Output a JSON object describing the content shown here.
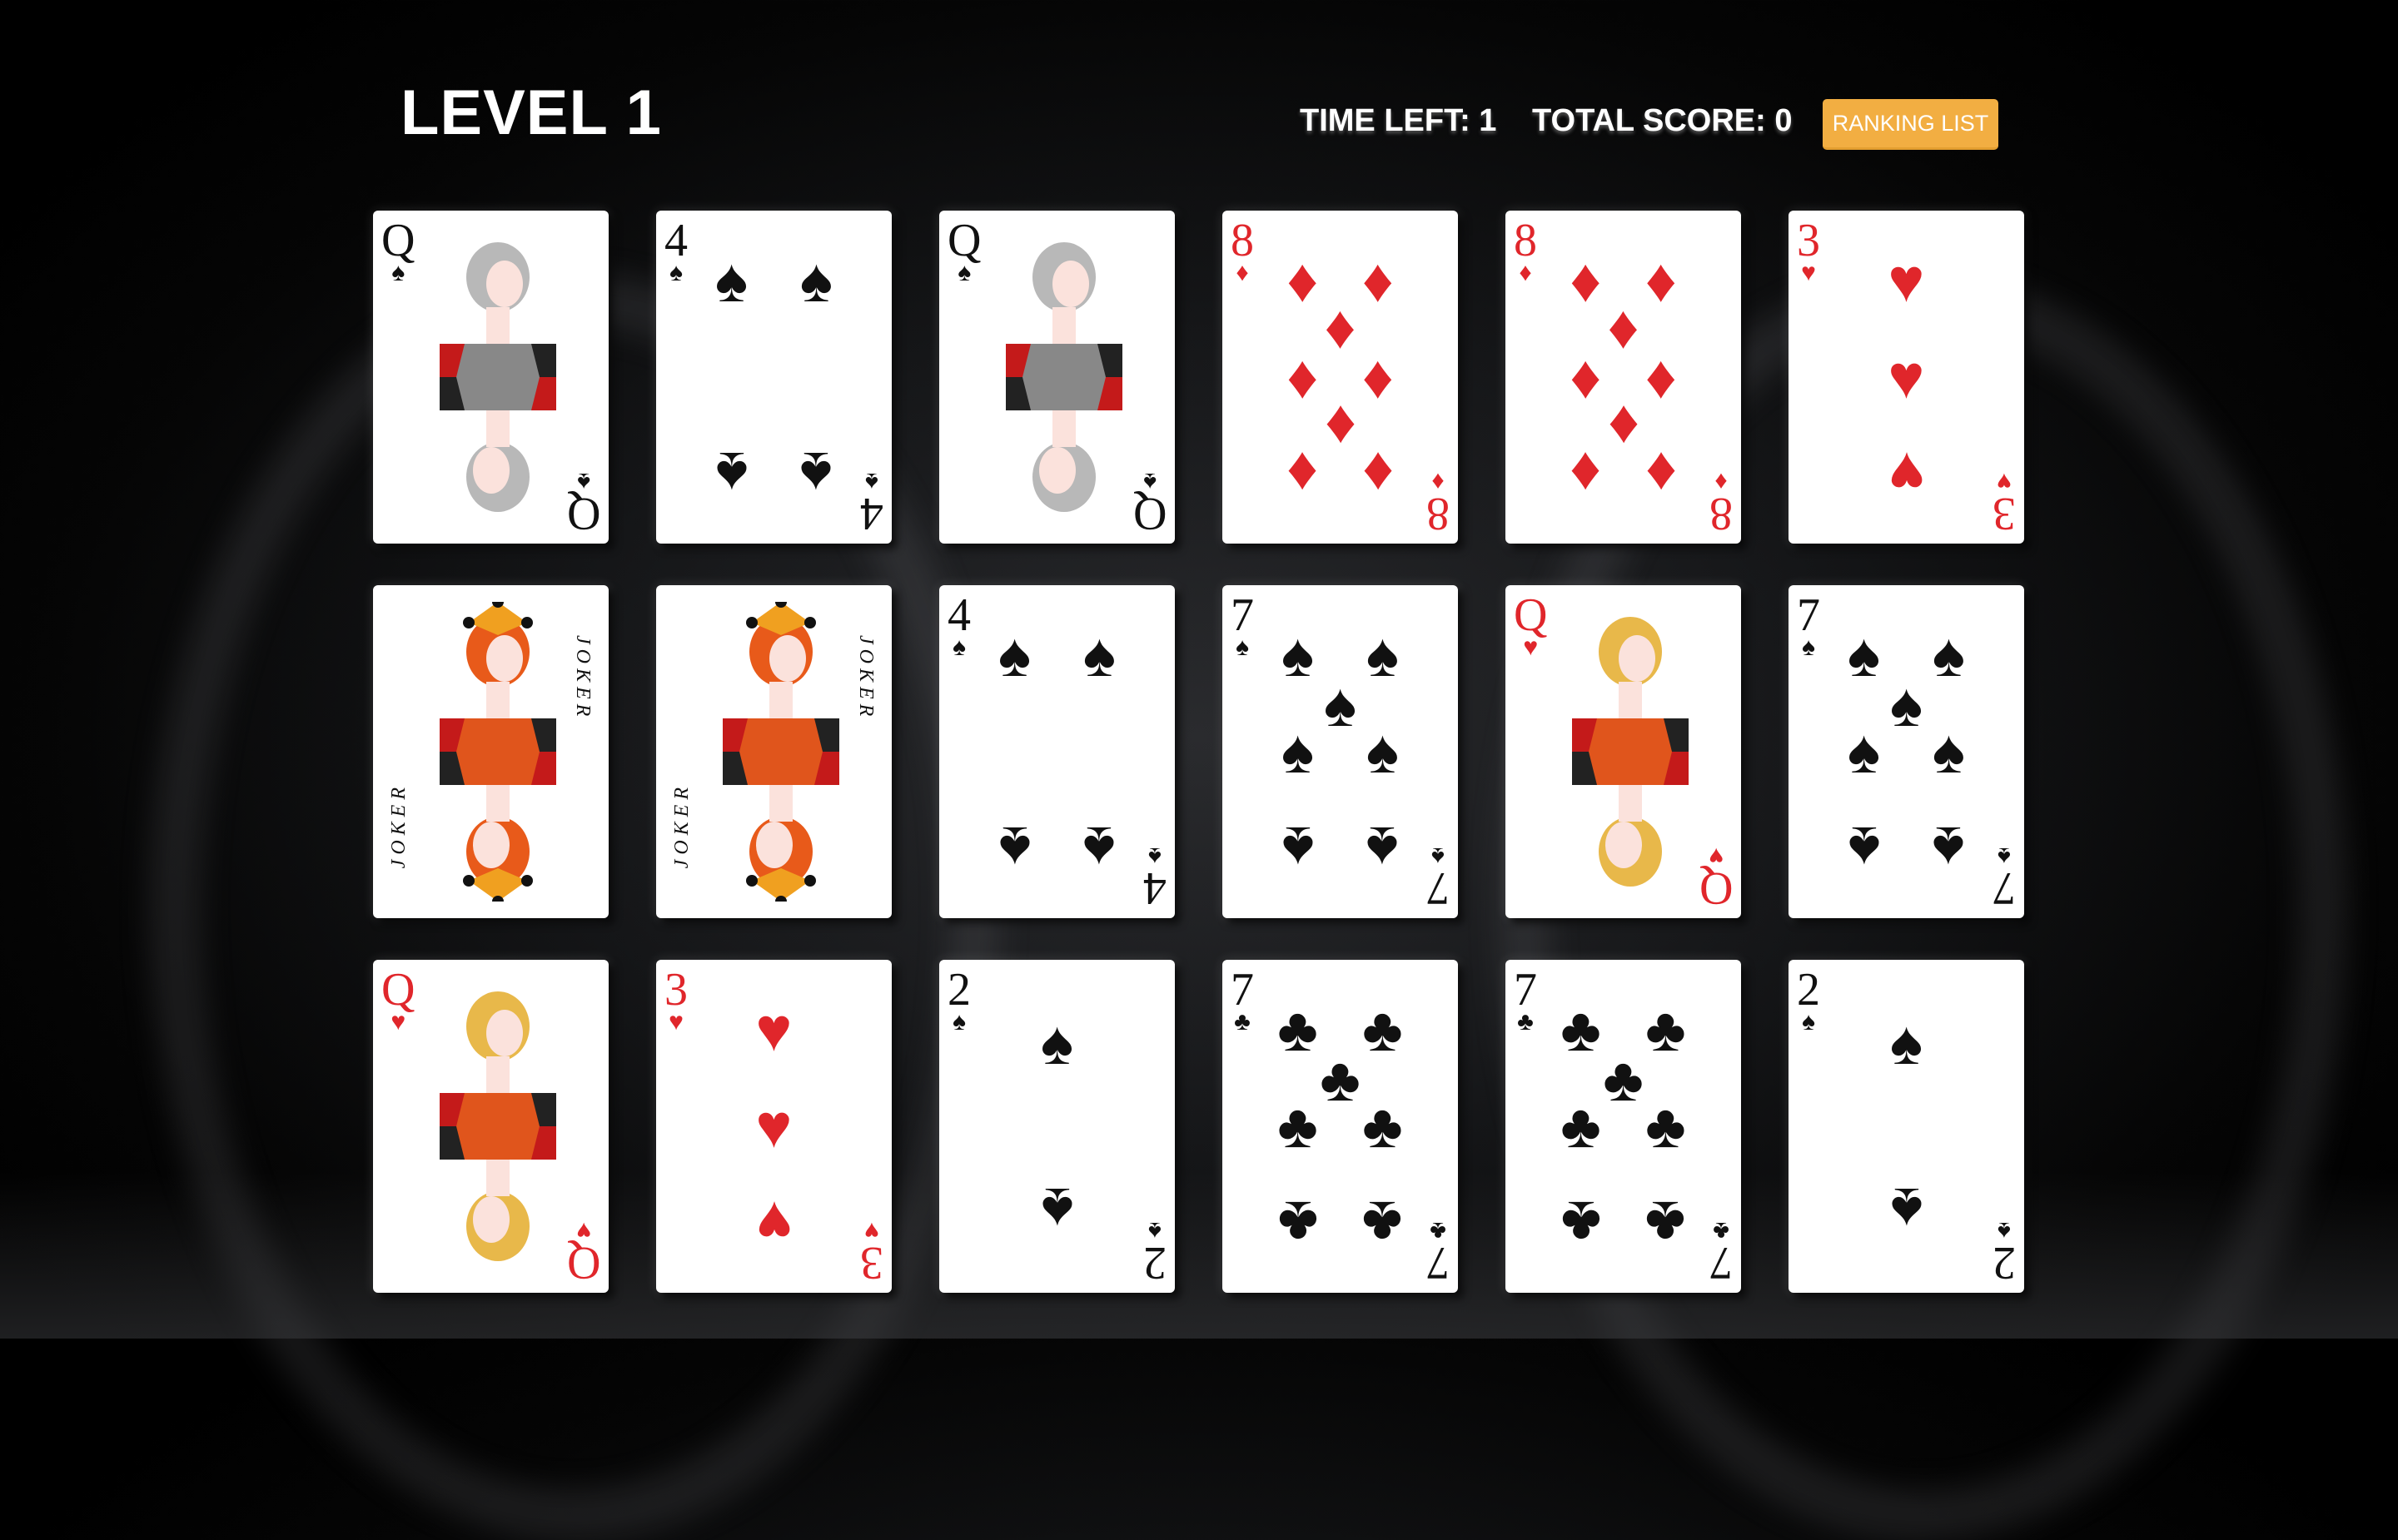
{
  "header": {
    "level": "LEVEL 1",
    "time_left": "TIME LEFT: 1",
    "total_score": "TOTAL SCORE: 0",
    "ranking_button": "RANKING LIST"
  },
  "colors": {
    "button": "#f2ae42",
    "red": "#e0262b",
    "black": "#111111"
  },
  "cards": [
    {
      "rank": "Q",
      "suit": "♠",
      "color": "black",
      "face": "queen-grey"
    },
    {
      "rank": "4",
      "suit": "♠",
      "color": "black"
    },
    {
      "rank": "Q",
      "suit": "♠",
      "color": "black",
      "face": "queen-grey"
    },
    {
      "rank": "8",
      "suit": "♦",
      "color": "red"
    },
    {
      "rank": "8",
      "suit": "♦",
      "color": "red"
    },
    {
      "rank": "3",
      "suit": "♥",
      "color": "red"
    },
    {
      "rank": "",
      "suit": "",
      "color": "black",
      "face": "joker",
      "label": "JOKER"
    },
    {
      "rank": "",
      "suit": "",
      "color": "black",
      "face": "joker",
      "label": "JOKER"
    },
    {
      "rank": "4",
      "suit": "♠",
      "color": "black"
    },
    {
      "rank": "7",
      "suit": "♠",
      "color": "black"
    },
    {
      "rank": "Q",
      "suit": "♥",
      "color": "red",
      "face": "queen-gold"
    },
    {
      "rank": "7",
      "suit": "♠",
      "color": "black"
    },
    {
      "rank": "Q",
      "suit": "♥",
      "color": "red",
      "face": "queen-gold"
    },
    {
      "rank": "3",
      "suit": "♥",
      "color": "red"
    },
    {
      "rank": "2",
      "suit": "♠",
      "color": "black"
    },
    {
      "rank": "7",
      "suit": "♣",
      "color": "black"
    },
    {
      "rank": "7",
      "suit": "♣",
      "color": "black"
    },
    {
      "rank": "2",
      "suit": "♠",
      "color": "black"
    }
  ]
}
